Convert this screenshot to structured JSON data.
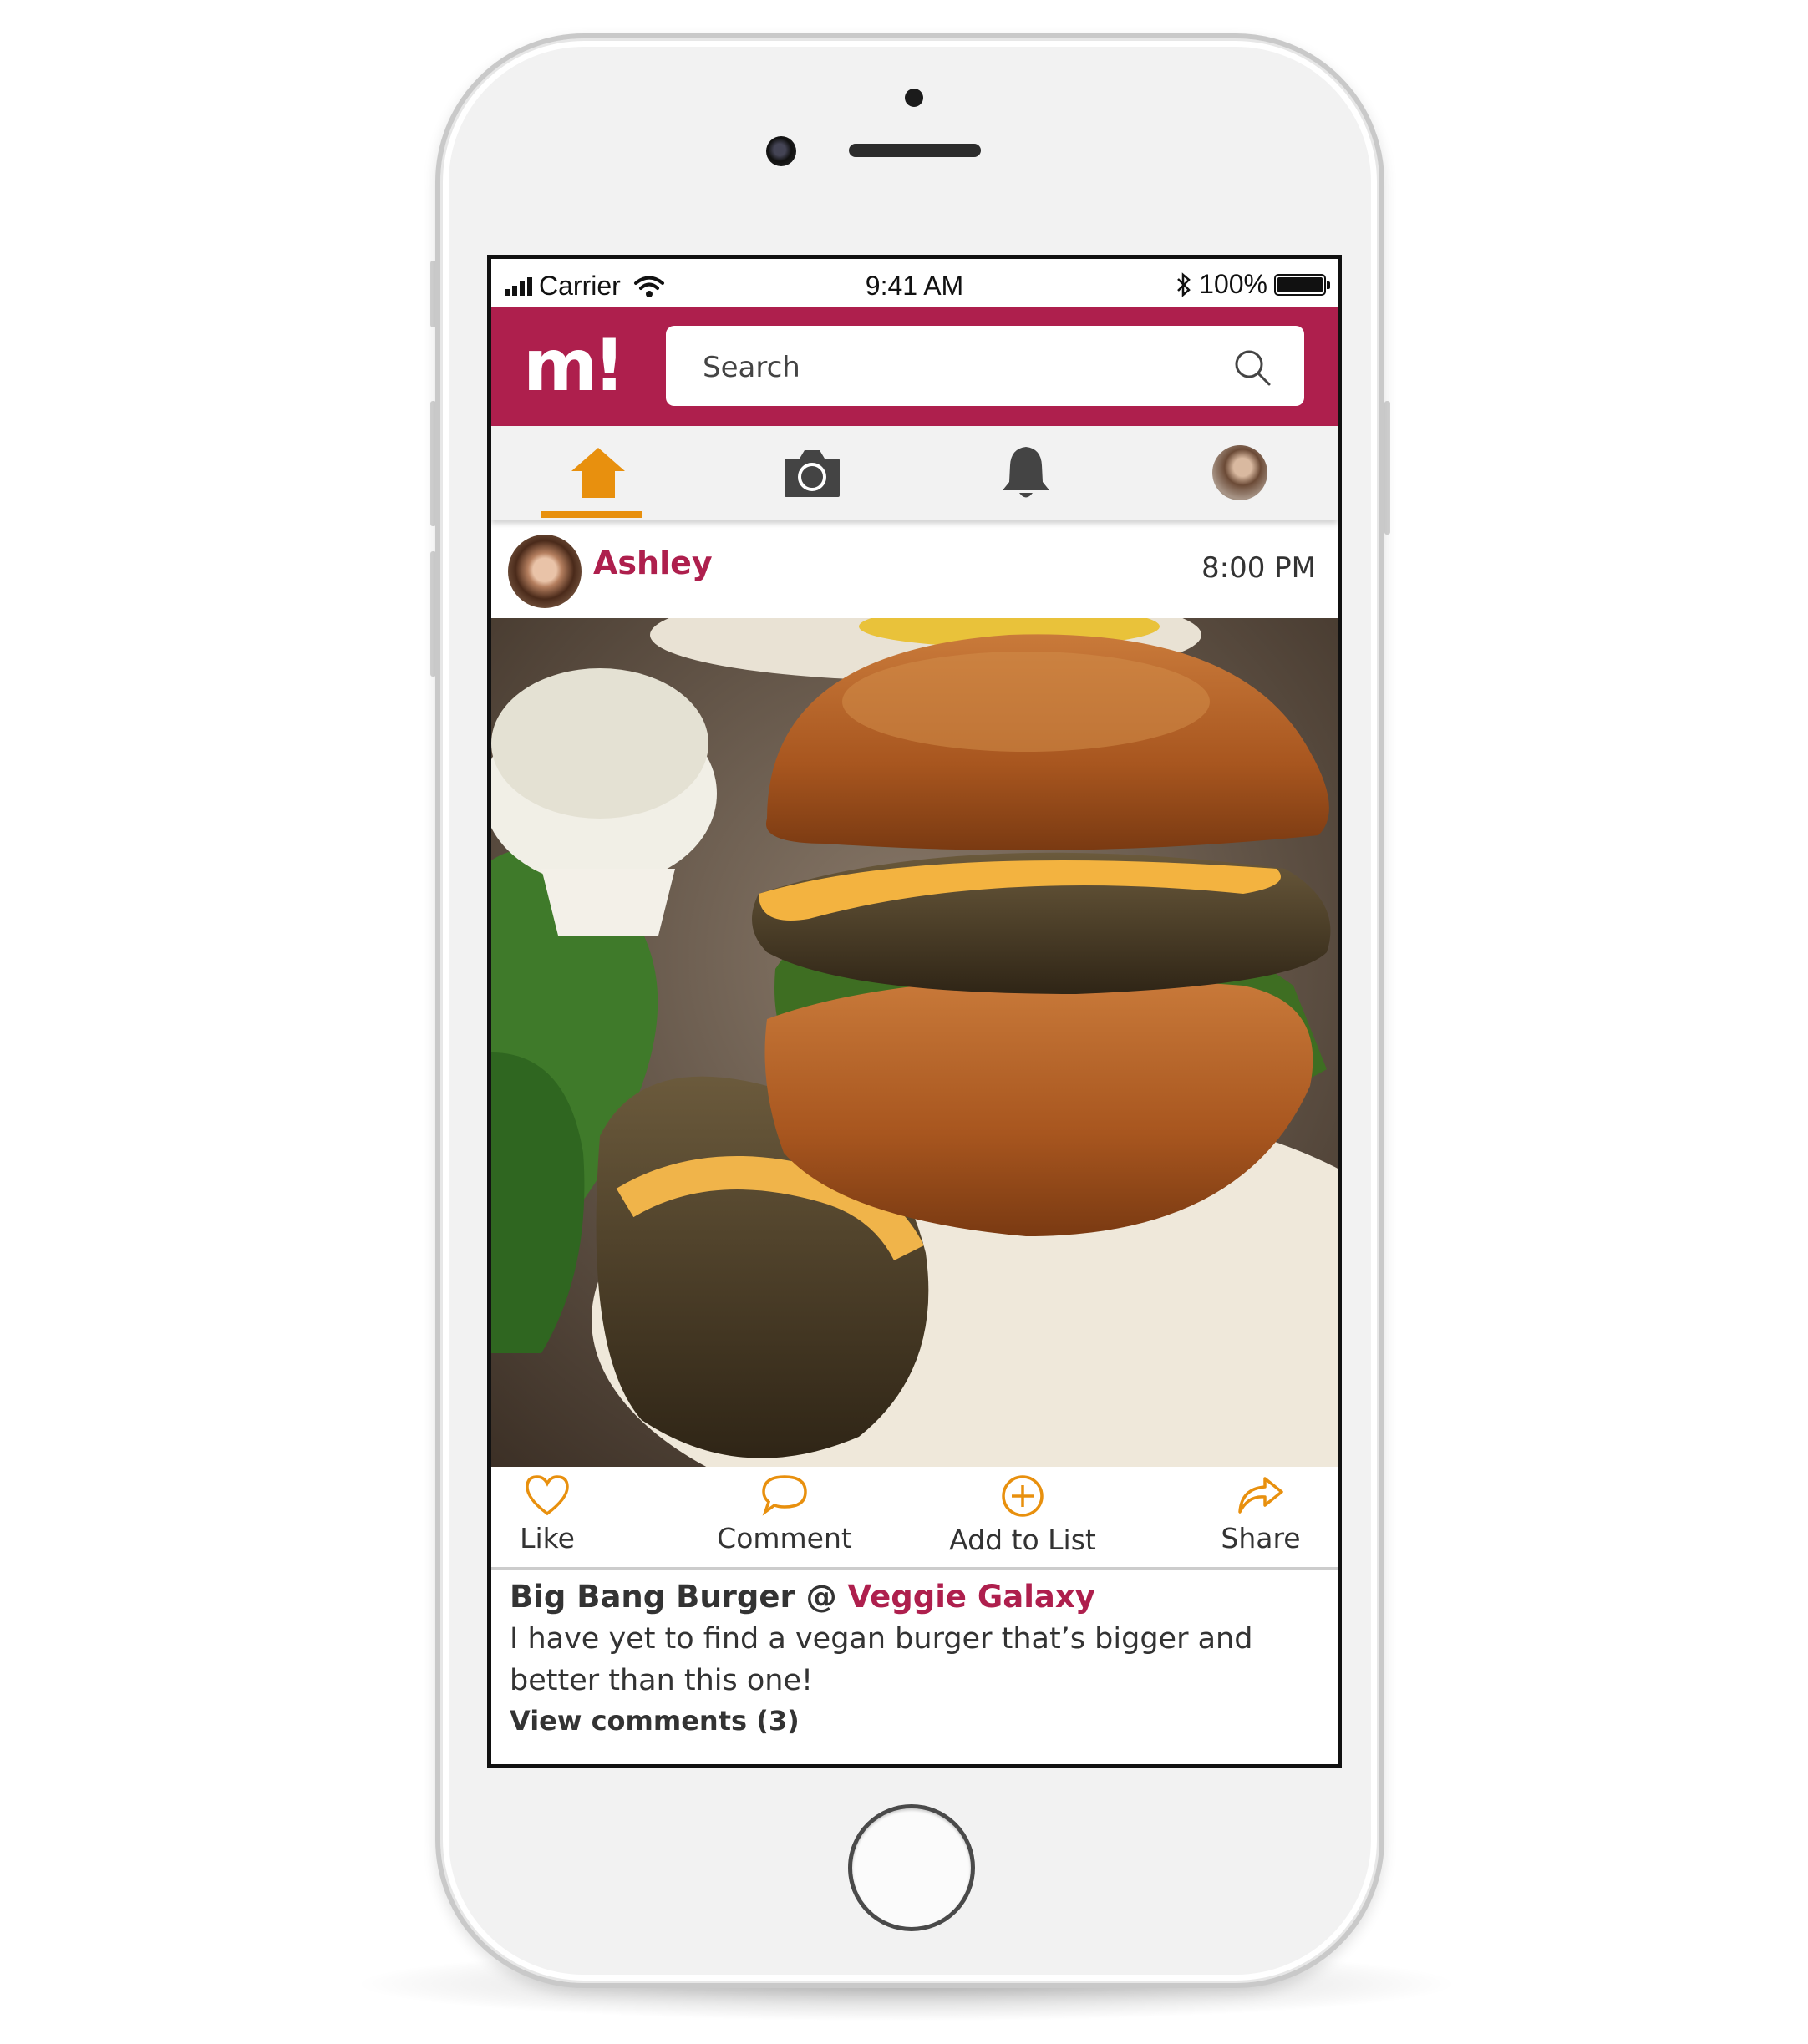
{
  "status_bar": {
    "carrier": "Carrier",
    "time": "9:41 AM",
    "battery": "100%"
  },
  "app": {
    "logo": "m!",
    "brand_color": "#ae1f4d",
    "accent_color": "#e8900e",
    "search": {
      "placeholder": "Search",
      "value": ""
    }
  },
  "tabs": [
    {
      "name": "home",
      "icon": "home-icon",
      "active": true
    },
    {
      "name": "camera",
      "icon": "camera-icon",
      "active": false
    },
    {
      "name": "notifications",
      "icon": "bell-icon",
      "active": false
    },
    {
      "name": "profile",
      "icon": "avatar",
      "active": false
    }
  ],
  "post": {
    "user": "Ashley",
    "time": "8:00 PM",
    "actions": [
      {
        "label": "Like",
        "icon": "heart-icon"
      },
      {
        "label": "Comment",
        "icon": "comment-icon"
      },
      {
        "label": "Add to List",
        "icon": "plus-circle-icon"
      },
      {
        "label": "Share",
        "icon": "share-icon"
      }
    ],
    "dish": "Big Bang Burger @ ",
    "venue": "Veggie Galaxy",
    "caption": "I have yet to find a vegan burger that’s bigger and better than this one!",
    "view_comments": "View comments (3)"
  }
}
